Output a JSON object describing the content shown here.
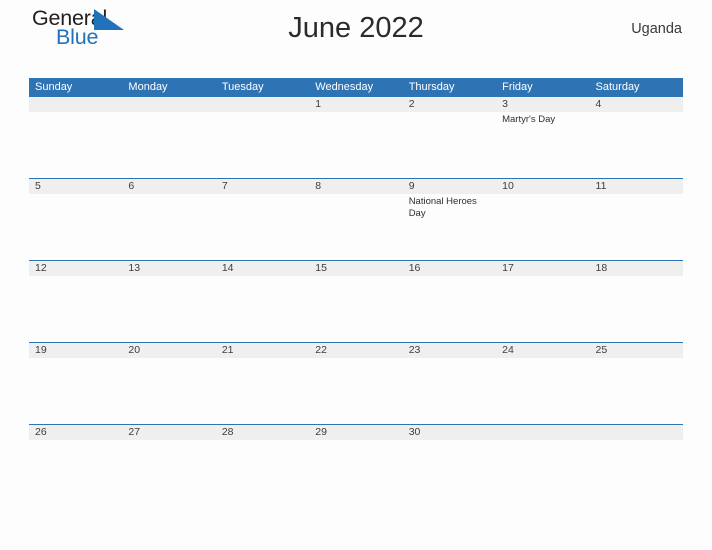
{
  "brand": {
    "name_part1": "General",
    "name_part2": "Blue",
    "triangle_icon": "triangle-logo-icon",
    "accent_color": "#2272bb"
  },
  "header": {
    "title": "June 2022",
    "country": "Uganda"
  },
  "colors": {
    "header_blue": "#2e74b5",
    "date_band_gray": "#efefef",
    "page_background": "#fdfdfd",
    "text": "#3a3a3a"
  },
  "calendar": {
    "month": "June",
    "year": "2022",
    "weekday_headers": [
      "Sunday",
      "Monday",
      "Tuesday",
      "Wednesday",
      "Thursday",
      "Friday",
      "Saturday"
    ],
    "weeks": [
      {
        "dates": [
          "",
          "",
          "",
          "1",
          "2",
          "3",
          "4"
        ],
        "events": [
          "",
          "",
          "",
          "",
          "",
          "Martyr's Day",
          ""
        ]
      },
      {
        "dates": [
          "5",
          "6",
          "7",
          "8",
          "9",
          "10",
          "11"
        ],
        "events": [
          "",
          "",
          "",
          "",
          "National Heroes Day",
          "",
          ""
        ]
      },
      {
        "dates": [
          "12",
          "13",
          "14",
          "15",
          "16",
          "17",
          "18"
        ],
        "events": [
          "",
          "",
          "",
          "",
          "",
          "",
          ""
        ]
      },
      {
        "dates": [
          "19",
          "20",
          "21",
          "22",
          "23",
          "24",
          "25"
        ],
        "events": [
          "",
          "",
          "",
          "",
          "",
          "",
          ""
        ]
      },
      {
        "dates": [
          "26",
          "27",
          "28",
          "29",
          "30",
          "",
          ""
        ],
        "events": [
          "",
          "",
          "",
          "",
          "",
          "",
          ""
        ]
      }
    ]
  }
}
